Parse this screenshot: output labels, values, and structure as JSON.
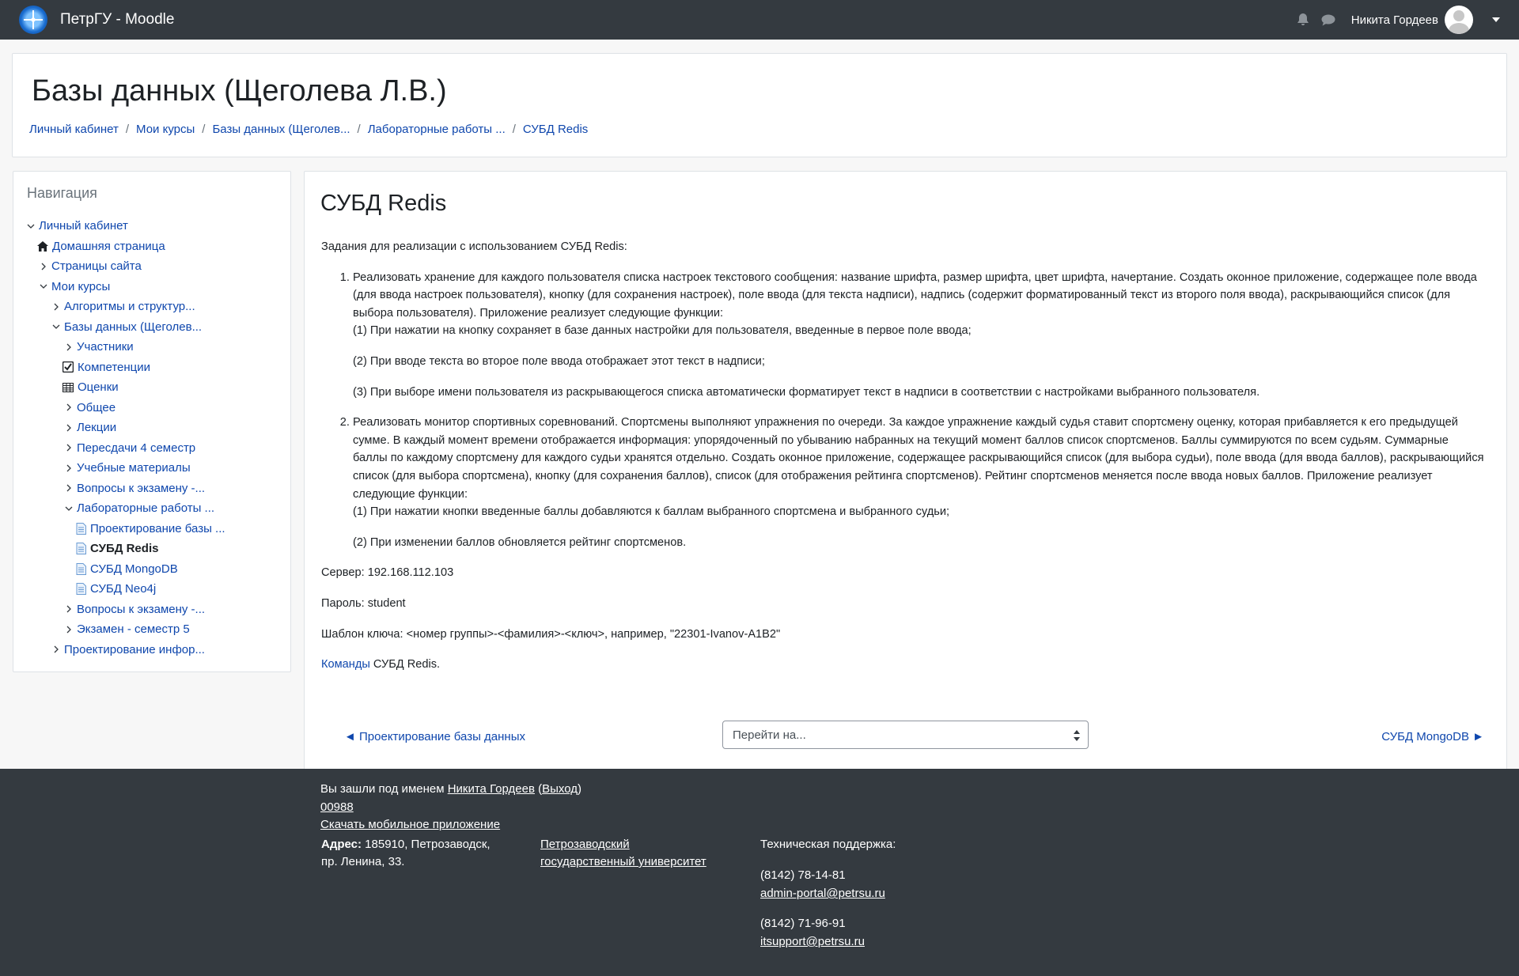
{
  "navbar": {
    "brand": "ПетрГУ - Moodle",
    "user_name": "Никита Гордеев"
  },
  "header": {
    "title": "Базы данных (Щеголева Л.В.)",
    "breadcrumbs": [
      "Личный кабинет",
      "Мои курсы",
      "Базы данных (Щеголев...",
      "Лабораторные работы ...",
      "СУБД Redis"
    ]
  },
  "navigation": {
    "title": "Навигация",
    "items": [
      {
        "label": "Личный кабинет",
        "level": 0,
        "chevron": "down"
      },
      {
        "label": "Домашняя страница",
        "level": 1,
        "icon": "home-icon"
      },
      {
        "label": "Страницы сайта",
        "level": 1,
        "chevron": "right"
      },
      {
        "label": "Мои курсы",
        "level": 1,
        "chevron": "down"
      },
      {
        "label": "Алгоритмы и структур...",
        "level": 2,
        "chevron": "right"
      },
      {
        "label": "Базы данных (Щеголев...",
        "level": 2,
        "chevron": "down"
      },
      {
        "label": "Участники",
        "level": 3,
        "chevron": "right"
      },
      {
        "label": "Компетенции",
        "level": 3,
        "icon": "checkbox-icon"
      },
      {
        "label": "Оценки",
        "level": 3,
        "icon": "table-icon"
      },
      {
        "label": "Общее",
        "level": 3,
        "chevron": "right"
      },
      {
        "label": "Лекции",
        "level": 3,
        "chevron": "right"
      },
      {
        "label": "Пересдачи 4 семестр",
        "level": 3,
        "chevron": "right"
      },
      {
        "label": "Учебные материалы",
        "level": 3,
        "chevron": "right"
      },
      {
        "label": "Вопросы к экзамену -...",
        "level": 3,
        "chevron": "right"
      },
      {
        "label": "Лабораторные работы ...",
        "level": 3,
        "chevron": "down"
      },
      {
        "label": "Проектирование базы ...",
        "level": 4,
        "icon": "page-icon"
      },
      {
        "label": "СУБД Redis",
        "level": 4,
        "icon": "page-icon",
        "active": true
      },
      {
        "label": "СУБД MongoDB",
        "level": 4,
        "icon": "page-icon"
      },
      {
        "label": "СУБД Neo4j",
        "level": 4,
        "icon": "page-icon"
      },
      {
        "label": "Вопросы к экзамену -...",
        "level": 3,
        "chevron": "right"
      },
      {
        "label": "Экзамен - семестр 5",
        "level": 3,
        "chevron": "right"
      },
      {
        "label": "Проектирование инфор...",
        "level": 2,
        "chevron": "right"
      }
    ]
  },
  "main": {
    "title": "СУБД Redis",
    "intro": "Задания для реализации с использованием СУБД Redis:",
    "task1": {
      "text": "Реализовать хранение для каждого пользователя списка настроек текстового сообщения: название шрифта, размер шрифта, цвет шрифта, начертание. Создать оконное приложение, содержащее поле ввода (для ввода настроек пользователя), кнопку (для сохранения настроек), поле ввода (для текста надписи), надпись (содержит форматированный текст из второго поля ввода), раскрывающийся список (для выбора пользователя). Приложение реализует следующие функции:",
      "f1": "(1) При нажатии на кнопку сохраняет в базе данных настройки для пользователя, введенные в первое поле ввода;",
      "f2": "(2) При вводе текста во второе поле ввода отображает этот текст в надписи;",
      "f3": "(3) При выборе имени пользователя из раскрывающегося списка автоматически форматирует текст в надписи в соответствии с настройками выбранного пользователя."
    },
    "task2": {
      "text": "Реализовать монитор спортивных соревнований. Спортсмены выполняют упражнения по очереди. За каждое упражнение каждый судья ставит спортсмену оценку, которая прибавляется к его предыдущей сумме. В каждый момент времени отображается информация: упорядоченный по убыванию набранных на текущий момент баллов список спортсменов. Баллы суммируются по всем судьям. Суммарные баллы по каждому спортсмену для каждого судьи хранятся отдельно. Создать оконное приложение, содержащее раскрывающийся список (для выбора судьи), поле ввода (для ввода баллов), раскрывающийся список (для выбора спортсмена), кнопку (для сохранения баллов), список (для отображения рейтинга спортсменов). Рейтинг спортсменов меняется после ввода новых баллов. Приложение реализует следующие функции:",
      "f1": "(1) При нажатии кнопки введенные баллы добавляются к баллам выбранного спортсмена и выбранного судьи;",
      "f2": "(2) При изменении баллов обновляется рейтинг спортсменов."
    },
    "server": "Сервер: 192.168.112.103",
    "password": "Пароль: student",
    "key_template": "Шаблон ключа: <номер группы>-<фамилия>-<ключ>, например, \"22301-Ivanov-A1B2\"",
    "commands_link": "Команды",
    "commands_rest": " СУБД Redis."
  },
  "activity_nav": {
    "prev": "◄ Проектирование базы данных",
    "jump_placeholder": "Перейти на...",
    "next": "СУБД MongoDB ►"
  },
  "footer": {
    "login_prefix": "Вы зашли под именем ",
    "login_user": "Никита Гордеев",
    "logout": "Выход",
    "code": "00988",
    "mobile_app": "Скачать мобильное приложение",
    "address_label": "Адрес:",
    "address_text": " 185910, Петрозаводск, пр. Ленина, 33.",
    "university": "Петрозаводский государственный университет",
    "support_title": "Техническая поддержка:",
    "phone1": "(8142) 78-14-81",
    "email1": "admin-portal@petrsu.ru",
    "phone2": "(8142) 71-96-91",
    "email2": "itsupport@petrsu.ru"
  }
}
